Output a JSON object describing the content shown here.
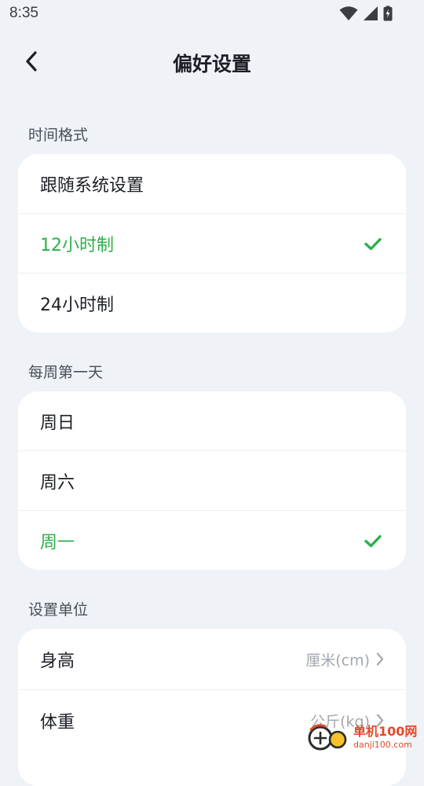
{
  "status_bar": {
    "time": "8:35",
    "icons": [
      "wifi-icon",
      "cellular-signal-icon",
      "battery-charging-icon"
    ]
  },
  "header": {
    "title": "偏好设置",
    "back_icon": "chevron-left-icon"
  },
  "time_format": {
    "section_label": "时间格式",
    "options": [
      {
        "label": "跟随系统设置",
        "selected": false
      },
      {
        "label": "12小时制",
        "selected": true
      },
      {
        "label": "24小时制",
        "selected": false
      }
    ]
  },
  "week_start": {
    "section_label": "每周第一天",
    "options": [
      {
        "label": "周日",
        "selected": false
      },
      {
        "label": "周六",
        "selected": false
      },
      {
        "label": "周一",
        "selected": true
      }
    ]
  },
  "units": {
    "section_label": "设置单位",
    "items": [
      {
        "label": "身高",
        "value": "厘米(cm)"
      },
      {
        "label": "体重",
        "value": "公斤(kg)"
      }
    ]
  },
  "watermark": {
    "name": "单机100网",
    "domain": "danji100.com"
  },
  "colors": {
    "accent": "#2bb04a",
    "background": "#eff2f7",
    "card": "#ffffff",
    "secondary_text": "#a3a7af"
  }
}
